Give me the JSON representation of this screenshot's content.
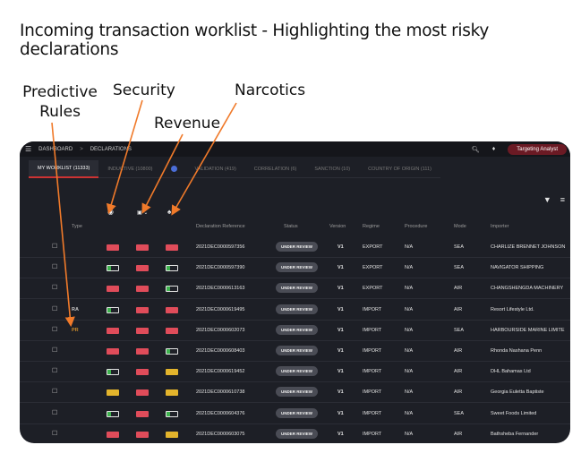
{
  "heading": "Incoming transaction worklist - Highlighting the most risky declarations",
  "callouts": {
    "predictive": "Predictive Rules",
    "security": "Security",
    "revenue": "Revenue",
    "narcotics": "Narcotics"
  },
  "topbar": {
    "menu_icon": "hamburger-icon",
    "crumb1": "DASHBOARD",
    "sep": ">",
    "crumb2": "DECLARATIONS",
    "search_icon": "search-icon",
    "bell_icon": "bell-icon",
    "analyst": "Targeting Analyst"
  },
  "tabs": [
    {
      "label": "MY WORKLIST (11333)",
      "active": true
    },
    {
      "label": "INDUCTIVE (10800)"
    },
    {
      "label": ""
    },
    {
      "label": "VALIDATION (419)"
    },
    {
      "label": "CORRELATION (6)"
    },
    {
      "label": "SANCTION (10)"
    },
    {
      "label": "COUNTRY OF ORIGIN (111)"
    }
  ],
  "tools": {
    "filter_icon": "filter-icon",
    "list_icon": "list-settings-icon"
  },
  "indicator_icons": {
    "security": "shield-icon",
    "revenue": "money-icon",
    "narcotics": "leaf-icon"
  },
  "columns": {
    "type": "Type",
    "ref": "Declaration Reference",
    "status": "Status",
    "version": "Version",
    "regime": "Regime",
    "procedure": "Procedure",
    "mode": "Mode",
    "importer": "Importer"
  },
  "rows": [
    {
      "type": "",
      "sec": "red",
      "rev": "red",
      "nar": "red",
      "ref": "2021DEC0000597356",
      "status": "UNDER REVIEW",
      "ver": "V1",
      "regime": "EXPORT",
      "proc": "N/A",
      "mode": "SEA",
      "importer": "CHARLIZE BRENNET JOHNSON"
    },
    {
      "type": "",
      "sec": "green",
      "rev": "red",
      "nar": "green",
      "ref": "2021DEC0000597390",
      "status": "UNDER REVIEW",
      "ver": "V1",
      "regime": "EXPORT",
      "proc": "N/A",
      "mode": "SEA",
      "importer": "NAVIGATOR SHIPPING"
    },
    {
      "type": "",
      "sec": "red",
      "rev": "red",
      "nar": "green",
      "ref": "2021DEC0000613163",
      "status": "UNDER REVIEW",
      "ver": "V1",
      "regime": "EXPORT",
      "proc": "N/A",
      "mode": "AIR",
      "importer": "CHANGSHENGDA MACHINERY"
    },
    {
      "type": "RA",
      "sec": "green",
      "rev": "red",
      "nar": "red",
      "ref": "2021DEC0000619495",
      "status": "UNDER REVIEW",
      "ver": "V1",
      "regime": "IMPORT",
      "proc": "N/A",
      "mode": "AIR",
      "importer": "Resort Lifestyle Ltd."
    },
    {
      "type": "PR",
      "sec": "red",
      "rev": "red",
      "nar": "red",
      "ref": "2021DEC0000602073",
      "status": "UNDER REVIEW",
      "ver": "V1",
      "regime": "IMPORT",
      "proc": "N/A",
      "mode": "SEA",
      "importer": "HARBOURSIDE MARINE LIMITE"
    },
    {
      "type": "",
      "sec": "red",
      "rev": "red",
      "nar": "green",
      "ref": "2021DEC0000608403",
      "status": "UNDER REVIEW",
      "ver": "V1",
      "regime": "IMPORT",
      "proc": "N/A",
      "mode": "AIR",
      "importer": "Rhonda Nashana Penn"
    },
    {
      "type": "",
      "sec": "green",
      "rev": "red",
      "nar": "yellow",
      "ref": "2021DEC0000619452",
      "status": "UNDER REVIEW",
      "ver": "V1",
      "regime": "IMPORT",
      "proc": "N/A",
      "mode": "AIR",
      "importer": "DHL Bahamas Ltd"
    },
    {
      "type": "",
      "sec": "yellow",
      "rev": "red",
      "nar": "yellow",
      "ref": "2021DEC0000610738",
      "status": "UNDER REVIEW",
      "ver": "V1",
      "regime": "IMPORT",
      "proc": "N/A",
      "mode": "AIR",
      "importer": "Georgia Euletta Baptiste"
    },
    {
      "type": "",
      "sec": "green",
      "rev": "red",
      "nar": "green",
      "ref": "2021DEC0000604376",
      "status": "UNDER REVIEW",
      "ver": "V1",
      "regime": "IMPORT",
      "proc": "N/A",
      "mode": "SEA",
      "importer": "Sweet Foods Limited"
    },
    {
      "type": "",
      "sec": "red",
      "rev": "red",
      "nar": "yellow",
      "ref": "2021DEC0000603075",
      "status": "UNDER REVIEW",
      "ver": "V1",
      "regime": "IMPORT",
      "proc": "N/A",
      "mode": "AIR",
      "importer": "Bathsheba Fernander"
    }
  ],
  "colors": {
    "accent": "#f07a2a",
    "red": "#e04c5a",
    "yellow": "#e3b42c",
    "green": "#3fb34f",
    "panel": "#1d1f26"
  }
}
